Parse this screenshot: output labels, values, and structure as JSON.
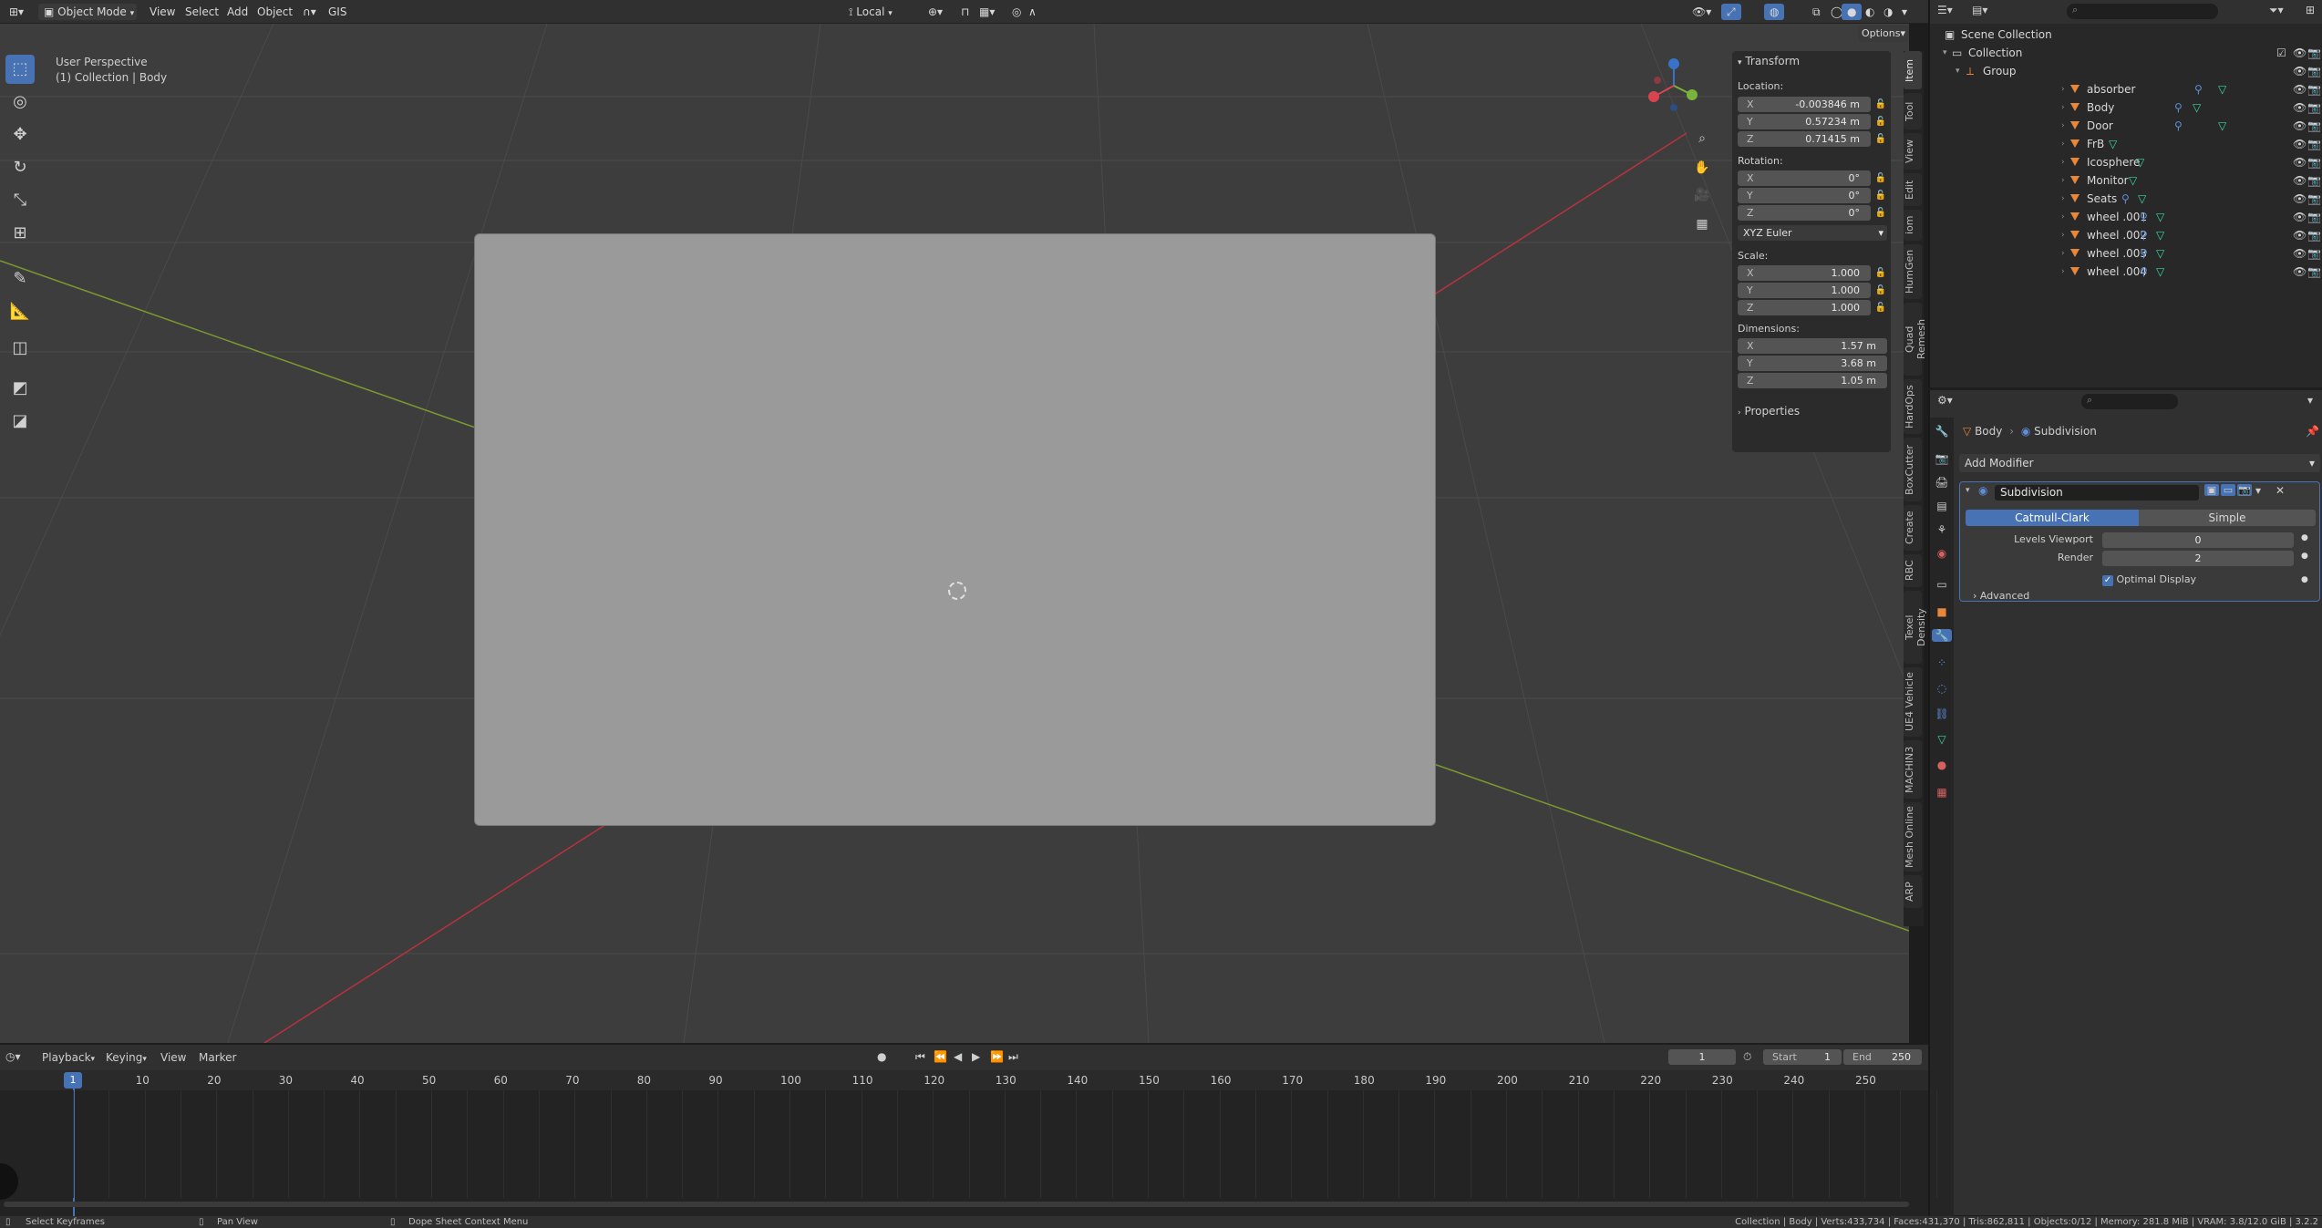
{
  "header": {
    "mode": "Object Mode",
    "menus": [
      "View",
      "Select",
      "Add",
      "Object",
      "GIS"
    ],
    "orientation": "Local",
    "options": "Options"
  },
  "viewport": {
    "perspective": "User Perspective",
    "context": "(1) Collection | Body"
  },
  "npanel": {
    "title": "Transform",
    "location_label": "Location:",
    "location": [
      {
        "axis": "X",
        "value": "-0.003846 m"
      },
      {
        "axis": "Y",
        "value": "0.57234 m"
      },
      {
        "axis": "Z",
        "value": "0.71415 m"
      }
    ],
    "rotation_label": "Rotation:",
    "rotation": [
      {
        "axis": "X",
        "value": "0°"
      },
      {
        "axis": "Y",
        "value": "0°"
      },
      {
        "axis": "Z",
        "value": "0°"
      }
    ],
    "rotation_mode": "XYZ Euler",
    "scale_label": "Scale:",
    "scale": [
      {
        "axis": "X",
        "value": "1.000"
      },
      {
        "axis": "Y",
        "value": "1.000"
      },
      {
        "axis": "Z",
        "value": "1.000"
      }
    ],
    "dimensions_label": "Dimensions:",
    "dimensions": [
      {
        "axis": "X",
        "value": "1.57 m"
      },
      {
        "axis": "Y",
        "value": "3.68 m"
      },
      {
        "axis": "Z",
        "value": "1.05 m"
      }
    ],
    "properties": "Properties"
  },
  "side_tabs": [
    "Item",
    "Tool",
    "View",
    "Edit",
    "iom",
    "HumGen",
    "Quad Remesh",
    "HardOps",
    "BoxCutter",
    "Create",
    "RBC",
    "Texel Density",
    "UE4 Vehicle",
    "MACHIN3",
    "Mesh Online",
    "ARP"
  ],
  "outliner": {
    "scene_collection": "Scene Collection",
    "collection": "Collection",
    "group": "Group",
    "items": [
      "absorber",
      "Body",
      "Door",
      "FrB",
      "Icosphere",
      "Monitor",
      "Seats",
      "wheel .001",
      "wheel .002",
      "wheel .003",
      "wheel .004"
    ]
  },
  "properties": {
    "breadcrumb_object": "Body",
    "breadcrumb_modifier": "Subdivision",
    "add_modifier": "Add Modifier",
    "modifier_name": "Subdivision",
    "catmull": "Catmull-Clark",
    "simple": "Simple",
    "levels_label": "Levels Viewport",
    "levels_value": "0",
    "render_label": "Render",
    "render_value": "2",
    "optimal_display": "Optimal Display",
    "advanced": "Advanced"
  },
  "timeline": {
    "menus": [
      "Playback",
      "Keying",
      "View",
      "Marker"
    ],
    "current_frame": "1",
    "start_label": "Start",
    "start": "1",
    "end_label": "End",
    "end": "250",
    "ticks": [
      "10",
      "20",
      "30",
      "40",
      "50",
      "60",
      "70",
      "80",
      "90",
      "100",
      "110",
      "120",
      "130",
      "140",
      "150",
      "160",
      "170",
      "180",
      "190",
      "200",
      "210",
      "220",
      "230",
      "240",
      "250"
    ],
    "playhead_label": "1"
  },
  "statusbar": {
    "left1": "Select Keyframes",
    "left2": "Pan View",
    "left3": "Dope Sheet Context Menu",
    "stats": "Collection | Body | Verts:433,734 | Faces:431,370 | Tris:862,811 | Objects:0/12 | Memory: 281.8 MiB | VRAM: 3.8/12.0 GiB | 3.2.2"
  },
  "colors": {
    "accent": "#4772b3",
    "viewport_bg": "#3d3d3d",
    "axis_x": "#b8323f",
    "axis_y": "#7a9a2f"
  }
}
